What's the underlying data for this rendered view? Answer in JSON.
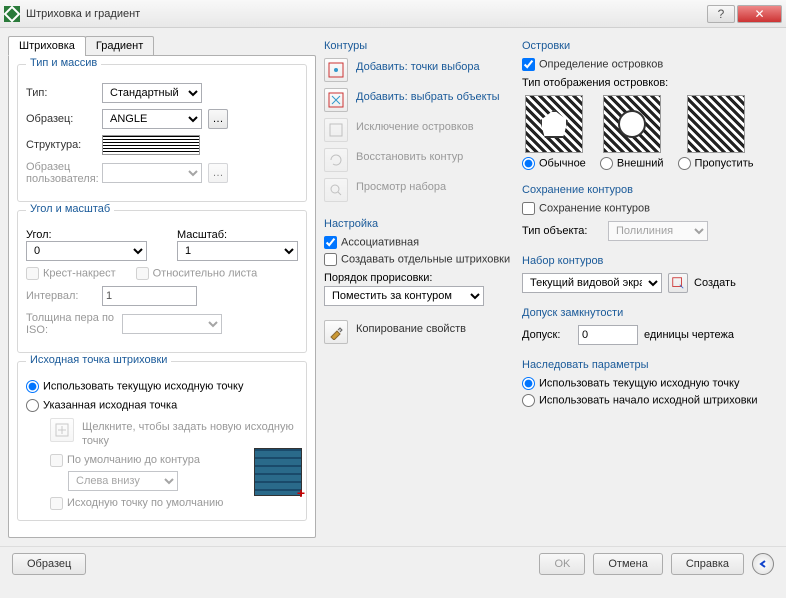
{
  "title": "Штриховка и градиент",
  "tabs": {
    "hatch": "Штриховка",
    "gradient": "Градиент"
  },
  "g1": {
    "title": "Тип и массив",
    "type_l": "Тип:",
    "type_v": "Стандартный",
    "pattern_l": "Образец:",
    "pattern_v": "ANGLE",
    "struct_l": "Структура:",
    "custom_l": "Образец пользователя:"
  },
  "g2": {
    "title": "Угол и масштаб",
    "angle_l": "Угол:",
    "angle_v": "0",
    "scale_l": "Масштаб:",
    "scale_v": "1",
    "cross": "Крест-накрест",
    "rel": "Относительно листа",
    "interval_l": "Интервал:",
    "interval_v": "1",
    "iso_l": "Толщина пера по ISO:"
  },
  "g3": {
    "title": "Исходная точка штриховки",
    "r1": "Использовать текущую исходную точку",
    "r2": "Указанная исходная точка",
    "click": "Щелкните, чтобы задать новую исходную точку",
    "def1": "По умолчанию до контура",
    "pos": "Слева внизу",
    "def2": "Исходную точку по умолчанию"
  },
  "c2": {
    "contours": "Контуры",
    "add_pts": "Добавить: точки выбора",
    "add_obj": "Добавить: выбрать объекты",
    "excl": "Исключение островков",
    "restore": "Восстановить контур",
    "view": "Просмотр набора",
    "settings": "Настройка",
    "assoc": "Ассоциативная",
    "sep": "Создавать отдельные штриховки",
    "order_l": "Порядок прорисовки:",
    "order_v": "Поместить за контуром",
    "copy": "Копирование свойств"
  },
  "c3": {
    "islands": "Островки",
    "detect": "Определение островков",
    "disp": "Тип отображения островков:",
    "m0": "Обычное",
    "m1": "Внешний",
    "m2": "Пропустить",
    "save": "Сохранение контуров",
    "save_ck": "Сохранение контуров",
    "objtype_l": "Тип объекта:",
    "objtype_v": "Полилиния",
    "set": "Набор контуров",
    "set_v": "Текущий видовой экран",
    "create": "Создать",
    "tol": "Допуск замкнутости",
    "tol_l": "Допуск:",
    "tol_v": "0",
    "units": "единицы чертежа",
    "inherit": "Наследовать параметры",
    "ir1": "Использовать текущую исходную точку",
    "ir2": "Использовать начало исходной штриховки"
  },
  "footer": {
    "sample": "Образец",
    "ok": "OK",
    "cancel": "Отмена",
    "help": "Справка"
  }
}
